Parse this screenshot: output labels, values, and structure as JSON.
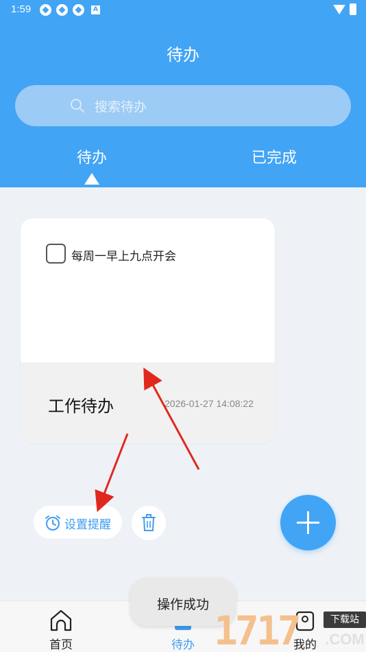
{
  "status_bar": {
    "time": "1:59",
    "notification_icons": [
      "sync-icon",
      "sync-icon",
      "sync-icon",
      "a-icon"
    ],
    "a_icon_label": "A"
  },
  "header": {
    "title": "待办",
    "search_placeholder": "搜索待办"
  },
  "tabs": [
    {
      "label": "待办",
      "selected": true
    },
    {
      "label": "已完成",
      "selected": false
    }
  ],
  "card": {
    "item_text": "每周一早上九点开会",
    "checked": false,
    "category": "工作待办",
    "timestamp": "2026-01-27 14:08:22"
  },
  "actions": {
    "reminder_label": "设置提醒"
  },
  "bottom_nav": [
    {
      "label": "首页",
      "icon": "home-icon",
      "active": false
    },
    {
      "label": "待办",
      "icon": "todo-list-icon",
      "active": true
    },
    {
      "label": "我的",
      "icon": "profile-icon",
      "active": false
    }
  ],
  "toast": {
    "text": "操作成功"
  },
  "watermark": {
    "number": "1717",
    "badge": "下载站",
    "domain": ".COM"
  },
  "colors": {
    "primary": "#42a4f5",
    "background": "#eef2f7",
    "arrow": "#e0281e"
  }
}
